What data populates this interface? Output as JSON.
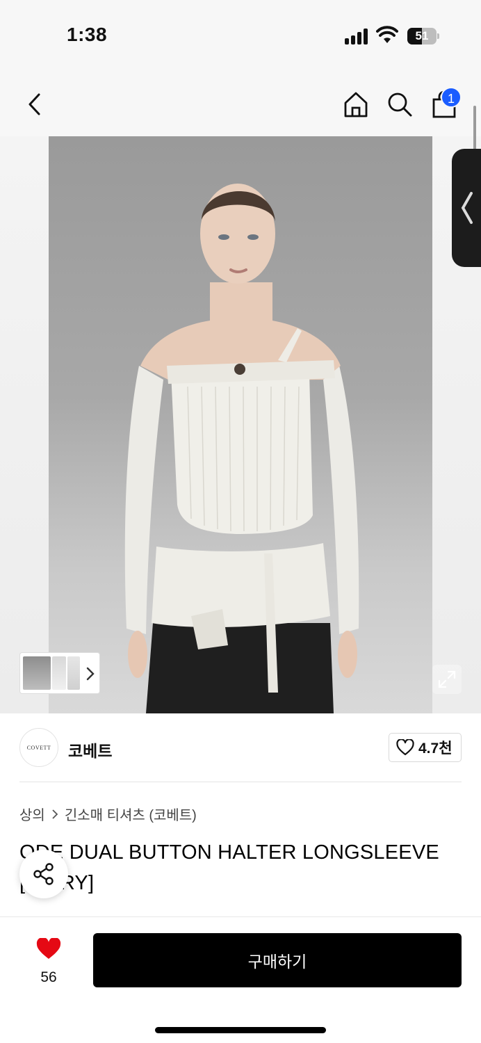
{
  "status": {
    "time": "1:38",
    "battery": "51",
    "battery_level": 0.51
  },
  "nav": {
    "back_icon": "chevron-left-icon",
    "home_icon": "home-icon",
    "search_icon": "search-icon",
    "cart_icon": "shopping-bag-icon",
    "cart_count": "1"
  },
  "gallery": {
    "expand_icon": "expand-icon",
    "thumbs_next_icon": "chevron-right-icon",
    "side_tab_icon": "chevron-left-icon"
  },
  "brand": {
    "logo_text": "COVETT",
    "name": "코베트",
    "likes": "4.7천"
  },
  "breadcrumb": {
    "category": "상의",
    "subcategory": "긴소매 티셔츠 (코베트)"
  },
  "product": {
    "title": "ODE DUAL BUTTON HALTER LONGSLEEVE [IVORY]"
  },
  "bottom": {
    "wish_count": "56",
    "buy_label": "구매하기"
  },
  "colors": {
    "accent_blue": "#1a5cff",
    "heart_red": "#e50914",
    "button_black": "#000000"
  }
}
